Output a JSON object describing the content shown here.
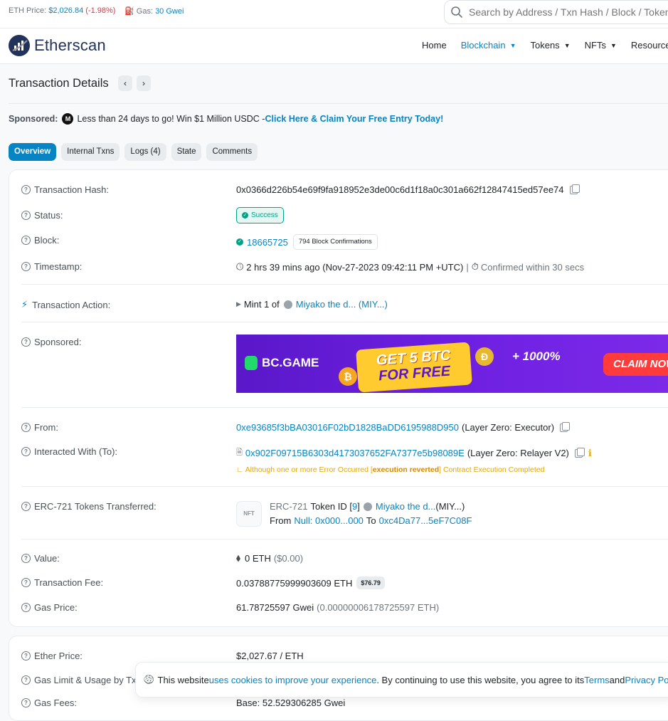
{
  "topbar": {
    "eth_price_label": "ETH Price:",
    "eth_price_value": "$2,026.84",
    "eth_price_change": "(-1.98%)",
    "gas_label": "Gas:",
    "gas_value": "30 Gwei",
    "search_placeholder": "Search by Address / Txn Hash / Block / Token / Domain Name"
  },
  "header": {
    "logo_text": "Etherscan",
    "nav": [
      "Home",
      "Blockchain",
      "Tokens",
      "NFTs",
      "Resources"
    ]
  },
  "page": {
    "title": "Transaction Details",
    "sponsored_label": "Sponsored:",
    "sponsored_text": "Less than 24 days to go! Win $1 Million USDC - ",
    "sponsored_cta": "Click Here & Claim Your Free Entry Today!",
    "sponsored_logo": "M"
  },
  "tabs": [
    "Overview",
    "Internal Txns",
    "Logs (4)",
    "State",
    "Comments"
  ],
  "details": {
    "hash_label": "Transaction Hash:",
    "hash_value": "0x0366d226b54e69f9fa918952e3de00c6d1f18a0c301a662f12847415ed57ee74",
    "status_label": "Status:",
    "status_value": "Success",
    "block_label": "Block:",
    "block_value": "18665725",
    "block_confirmations": "794 Block Confirmations",
    "timestamp_label": "Timestamp:",
    "timestamp_value": "2 hrs 39 mins ago (Nov-27-2023 09:42:11 PM +UTC)",
    "timestamp_confirmed": "Confirmed within 30 secs",
    "action_label": "Transaction Action:",
    "action_prefix": "Mint 1 of",
    "action_token": "Miyako the d... (MIY...)",
    "sponsored_label": "Sponsored:",
    "banner": {
      "brand": "BC.GAME",
      "line1": "GET 5 BTC",
      "line2": "FOR FREE",
      "bonus": "+ 1000%",
      "claim": "CLAIM NOW"
    },
    "from_label": "From:",
    "from_address": "0xe93685f3bBA03016F02bD1828BaDD6195988D950",
    "from_name": "(Layer Zero: Executor)",
    "to_label": "Interacted With (To):",
    "to_address": "0x902F09715B6303d4173037652FA7377e5b98089E",
    "to_name": "(Layer Zero: Relayer V2)",
    "error_prefix": "Although one or more Error Occurred [",
    "error_bold": "execution reverted",
    "error_suffix": "] Contract Execution Completed",
    "erc721_label": "ERC-721 Tokens Transferred:",
    "erc721_box": "NFT",
    "erc721_standard": "ERC-721",
    "erc721_token_id_label": "Token ID [",
    "erc721_token_id": "9",
    "erc721_token_id_close": "]",
    "erc721_token": "Miyako the d...",
    "erc721_token_suffix": "(MIY...)",
    "erc721_from_label": "From",
    "erc721_from": "Null: 0x000...000",
    "erc721_to_label": "To",
    "erc721_to": "0xc4Da77...5eF7C08F",
    "value_label": "Value:",
    "value_value": "0 ETH",
    "value_usd": "($0.00)",
    "fee_label": "Transaction Fee:",
    "fee_value": "0.03788775999903609 ETH",
    "fee_usd": "$76.79",
    "gas_price_label": "Gas Price:",
    "gas_price_value": "61.78725597 Gwei",
    "gas_price_eth": "(0.00000006178725597 ETH)"
  },
  "details2": {
    "ether_price_label": "Ether Price:",
    "ether_price_value": "$2,027.67 / ETH",
    "gas_limit_label": "Gas Limit & Usage by Txn:",
    "gas_fees_label": "Gas Fees:",
    "gas_fees_value": "Base: 52.529306285 Gwei"
  },
  "cookie": {
    "text1": "This website ",
    "link1": "uses cookies to improve your experience",
    "text2": ". By continuing to use this website, you agree to its ",
    "link2": "Terms",
    "text3": " and ",
    "link3": "Privacy Policy"
  }
}
